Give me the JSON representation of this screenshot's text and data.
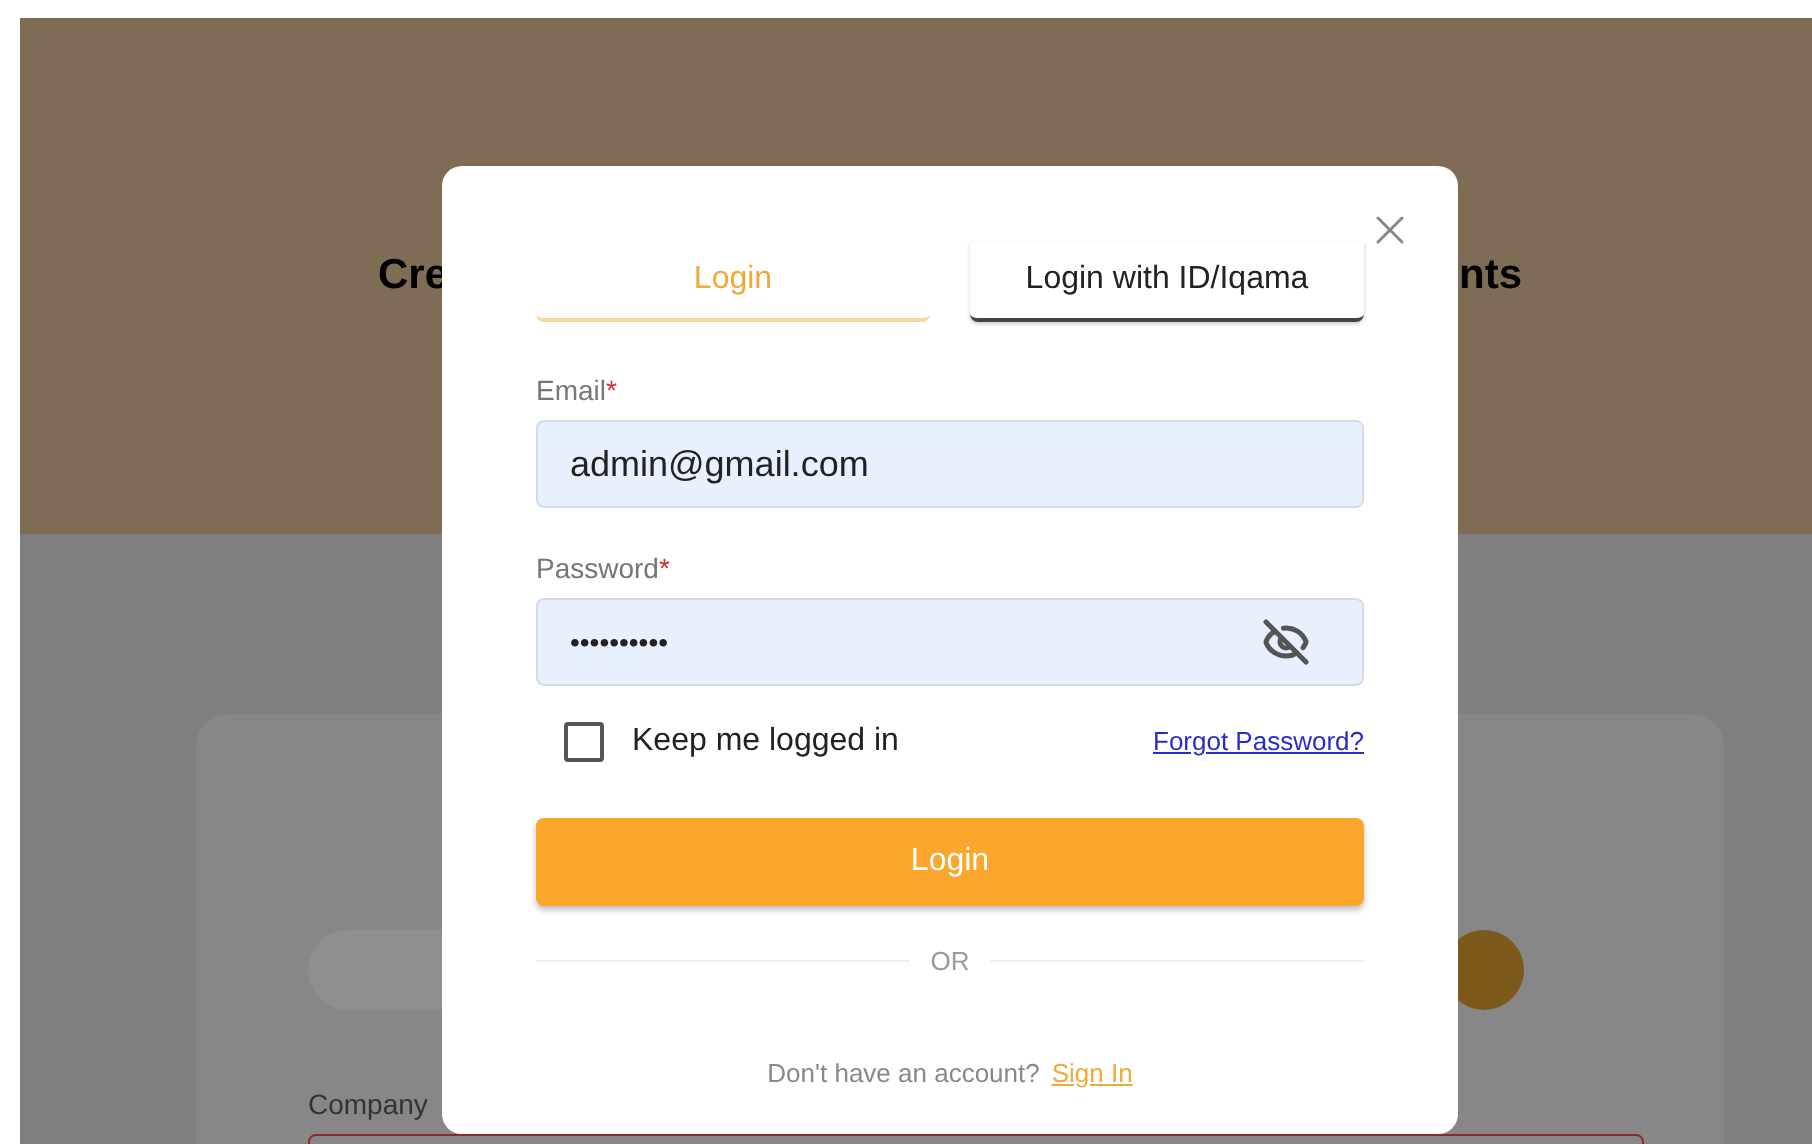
{
  "background": {
    "heading_start": "Cre",
    "heading_end": "nts",
    "company_label": "Company"
  },
  "dialog": {
    "tabs": [
      {
        "label": "Login",
        "selected": true
      },
      {
        "label": "Login with ID/Iqama",
        "selected": false
      }
    ],
    "email": {
      "label": "Email",
      "required_mark": "*",
      "value": "admin@gmail.com"
    },
    "password": {
      "label": "Password",
      "required_mark": "*",
      "value": "••••••••••"
    },
    "keep_logged_in": {
      "label": "Keep me logged in",
      "checked": false
    },
    "forgot_link": "Forgot Password?",
    "login_button": "Login",
    "divider_text": "OR",
    "signup_prompt": "Don't have an account?",
    "signup_link": "Sign In"
  }
}
